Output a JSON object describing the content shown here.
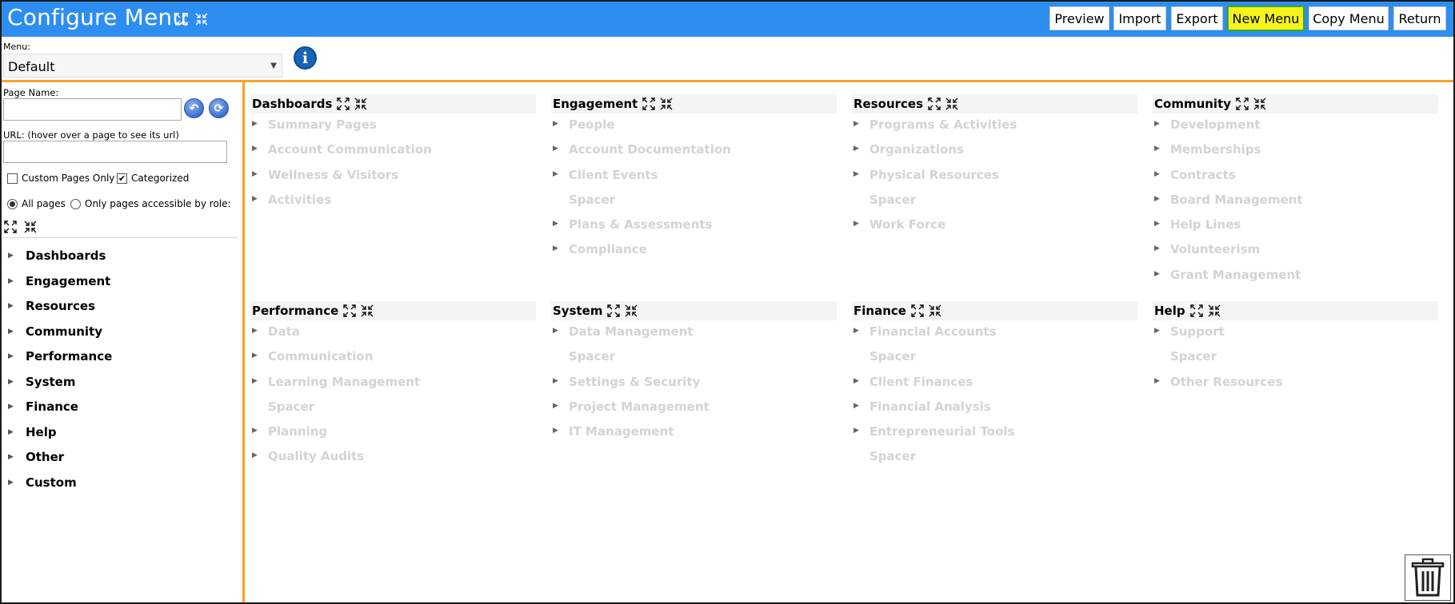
{
  "header": {
    "title": "Configure Menu",
    "buttons": [
      {
        "label": "Preview"
      },
      {
        "label": "Import"
      },
      {
        "label": "Export"
      },
      {
        "label": "New Menu"
      },
      {
        "label": "Copy Menu"
      },
      {
        "label": "Return"
      }
    ]
  },
  "menu": {
    "label": "Menu:",
    "selected": "Default"
  },
  "left": {
    "page_name_label": "Page Name:",
    "page_name_value": "",
    "url_label": "URL: (hover over a page to see its url)",
    "url_value": "",
    "custom_only_label": "Custom Pages Only",
    "custom_only_checked": false,
    "categorized_label": "Categorized",
    "categorized_checked": true,
    "all_pages_label": "All pages",
    "role_pages_label": "Only pages accessible by role:",
    "categories": [
      "Dashboards",
      "Engagement",
      "Resources",
      "Community",
      "Performance",
      "System",
      "Finance",
      "Help",
      "Other",
      "Custom"
    ]
  },
  "sections": [
    {
      "title": "Dashboards",
      "items": [
        {
          "label": "Summary Pages",
          "expandable": true
        },
        {
          "label": "Account Communication",
          "expandable": true
        },
        {
          "label": "Wellness & Visitors",
          "expandable": true
        },
        {
          "label": "Activities",
          "expandable": true
        }
      ]
    },
    {
      "title": "Engagement",
      "items": [
        {
          "label": "People",
          "expandable": true
        },
        {
          "label": "Account Documentation",
          "expandable": true
        },
        {
          "label": "Client Events",
          "expandable": true
        },
        {
          "label": "Spacer",
          "expandable": false
        },
        {
          "label": "Plans & Assessments",
          "expandable": true
        },
        {
          "label": "Compliance",
          "expandable": true
        }
      ]
    },
    {
      "title": "Resources",
      "items": [
        {
          "label": "Programs & Activities",
          "expandable": true
        },
        {
          "label": "Organizations",
          "expandable": true
        },
        {
          "label": "Physical Resources",
          "expandable": true
        },
        {
          "label": "Spacer",
          "expandable": false
        },
        {
          "label": "Work Force",
          "expandable": true
        }
      ]
    },
    {
      "title": "Community",
      "items": [
        {
          "label": "Development",
          "expandable": true
        },
        {
          "label": "Memberships",
          "expandable": true
        },
        {
          "label": "Contracts",
          "expandable": true
        },
        {
          "label": "Board Management",
          "expandable": true
        },
        {
          "label": "Help Lines",
          "expandable": true
        },
        {
          "label": "Volunteerism",
          "expandable": true
        },
        {
          "label": "Grant Management",
          "expandable": true
        }
      ]
    },
    {
      "title": "Performance",
      "items": [
        {
          "label": "Data",
          "expandable": true
        },
        {
          "label": "Communication",
          "expandable": true
        },
        {
          "label": "Learning Management",
          "expandable": true
        },
        {
          "label": "Spacer",
          "expandable": false
        },
        {
          "label": "Planning",
          "expandable": true
        },
        {
          "label": "Quality Audits",
          "expandable": true
        }
      ]
    },
    {
      "title": "System",
      "items": [
        {
          "label": "Data Management",
          "expandable": true
        },
        {
          "label": "Spacer",
          "expandable": false
        },
        {
          "label": "Settings & Security",
          "expandable": true
        },
        {
          "label": "Project Management",
          "expandable": true
        },
        {
          "label": "IT Management",
          "expandable": true
        }
      ]
    },
    {
      "title": "Finance",
      "items": [
        {
          "label": "Financial Accounts",
          "expandable": true
        },
        {
          "label": "Spacer",
          "expandable": false
        },
        {
          "label": "Client Finances",
          "expandable": true
        },
        {
          "label": "Financial Analysis",
          "expandable": true
        },
        {
          "label": "Entrepreneurial Tools",
          "expandable": true
        },
        {
          "label": "Spacer",
          "expandable": false
        }
      ]
    },
    {
      "title": "Help",
      "items": [
        {
          "label": "Support",
          "expandable": true
        },
        {
          "label": "Spacer",
          "expandable": false
        },
        {
          "label": "Other Resources",
          "expandable": true
        }
      ]
    }
  ],
  "icons": {
    "expand": "expand-all-icon",
    "collapse": "collapse-all-icon",
    "info": "info-icon",
    "trash": "trash-icon"
  },
  "colors": {
    "header_bg": "#2e8df0",
    "accent_rule": "#f5a623",
    "highlight_button": "#f4f41c",
    "highlight_border": "#3ea81f",
    "inactive_item": "#d3d3d3"
  }
}
